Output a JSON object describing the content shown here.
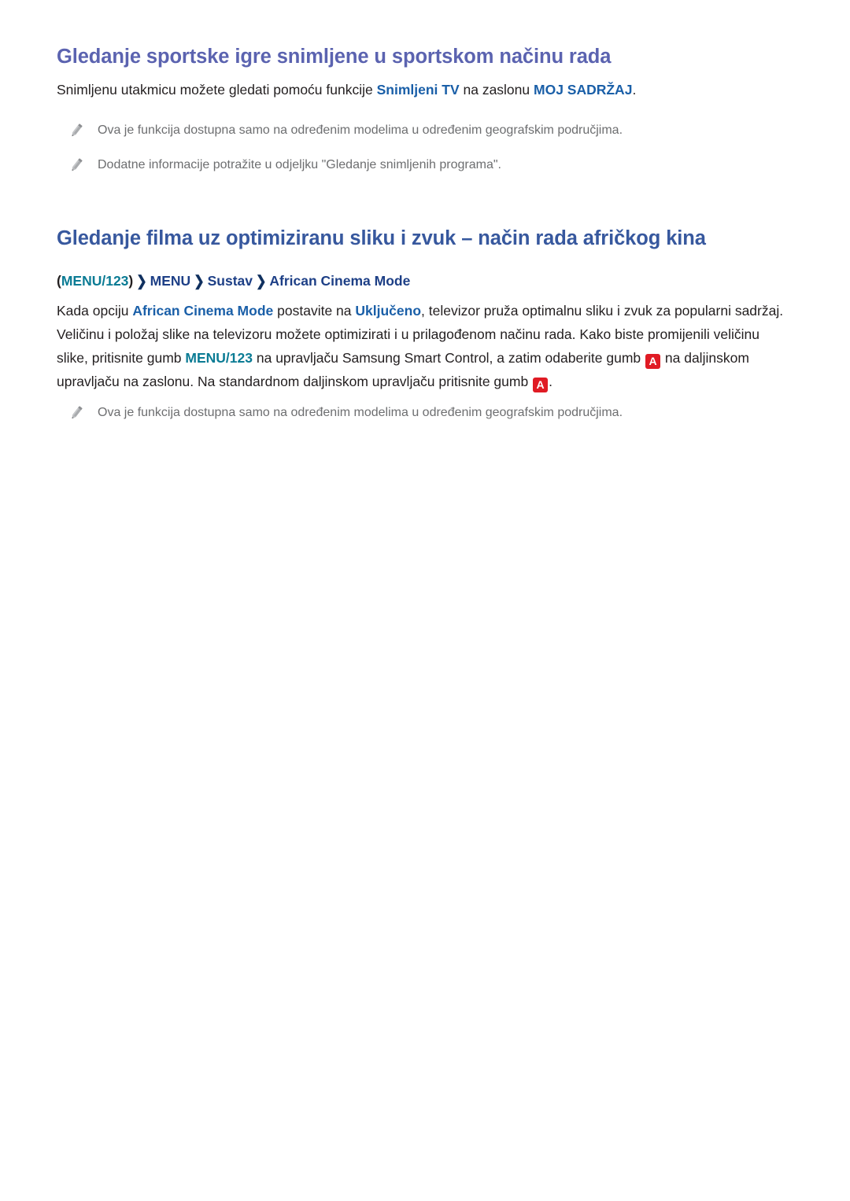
{
  "document": {
    "language": "hr",
    "colors": {
      "heading_purple": "#5b63b0",
      "heading_blue": "#37589e",
      "keyword_blue": "#1a5fa8",
      "keyword_teal": "#0a7b94",
      "breadcrumb_navy": "#1d3f86",
      "body_text": "#231f20",
      "note_text": "#6d6e70",
      "key_badge_red": "#e01b24",
      "background": "#ffffff"
    }
  },
  "section1": {
    "title": "Gledanje sportske igre snimljene u sportskom načinu rada",
    "paragraph": {
      "part1": "Snimljenu utakmicu možete gledati pomoću funkcije ",
      "kw1": "Snimljeni TV",
      "part2": " na zaslonu ",
      "kw2": "MOJ SADRŽAJ",
      "part3": "."
    },
    "notes": [
      {
        "icon": "pencil-icon",
        "text": "Ova je funkcija dostupna samo na određenim modelima u određenim geografskim područjima."
      },
      {
        "icon": "pencil-icon",
        "text": "Dodatne informacije potražite u odjeljku \"Gledanje snimljenih programa\"."
      }
    ]
  },
  "section2": {
    "title": "Gledanje filma uz optimiziranu sliku i zvuk – način rada afričkog kina",
    "breadcrumb": {
      "open_paren": "(",
      "item0": "MENU/123",
      "close_paren": ")",
      "chevron": "❯",
      "item1": "MENU",
      "item2": "Sustav",
      "item3": "African Cinema Mode"
    },
    "paragraph": {
      "p1": "Kada opciju ",
      "kw1": "African Cinema Mode",
      "p2": " postavite na ",
      "kw2": "Uključeno",
      "p3": ", televizor pruža optimalnu sliku i zvuk za popularni sadržaj. Veličinu i položaj slike na televizoru možete optimizirati i u prilagođenom načinu rada. Kako biste promijenili veličinu slike, pritisnite gumb ",
      "kw3": "MENU/123",
      "p4": " na upravljaču Samsung Smart Control, a zatim odaberite gumb ",
      "key1": "A",
      "p5": " na daljinskom upravljaču na zaslonu. Na standardnom daljinskom upravljaču pritisnite gumb ",
      "key2": "A",
      "p6": "."
    },
    "notes": [
      {
        "icon": "pencil-icon",
        "text": "Ova je funkcija dostupna samo na određenim modelima u određenim geografskim područjima."
      }
    ]
  }
}
